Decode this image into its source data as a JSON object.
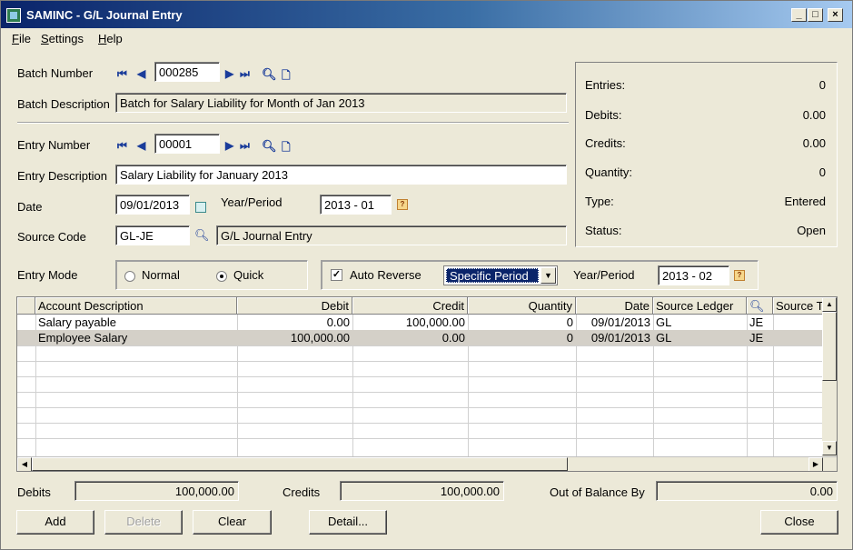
{
  "window": {
    "title": "SAMINC - G/L Journal Entry",
    "minimize": "_",
    "maximize": "□",
    "close": "×"
  },
  "menu": {
    "file": "File",
    "settings": "Settings",
    "help": "Help"
  },
  "batch": {
    "number_label": "Batch Number",
    "number": "000285",
    "description_label": "Batch Description",
    "description": "Batch for Salary Liability for Month of Jan 2013"
  },
  "entry": {
    "number_label": "Entry Number",
    "number": "00001",
    "description_label": "Entry Description",
    "description": "Salary Liability for January 2013",
    "date_label": "Date",
    "date": "09/01/2013",
    "year_period_label": "Year/Period",
    "year_period": "2013 - 01",
    "source_code_label": "Source Code",
    "source_code": "GL-JE",
    "source_code_desc": "G/L Journal Entry",
    "mode_label": "Entry Mode",
    "mode_normal": "Normal",
    "mode_quick": "Quick",
    "mode_selected": "Quick",
    "auto_reverse_label": "Auto Reverse",
    "auto_reverse_checked": true,
    "reverse_option": "Specific Period",
    "reverse_year_period_label": "Year/Period",
    "reverse_year_period": "2013 - 02"
  },
  "summary": {
    "entries_label": "Entries:",
    "entries": "0",
    "debits_label": "Debits:",
    "debits": "0.00",
    "credits_label": "Credits:",
    "credits": "0.00",
    "quantity_label": "Quantity:",
    "quantity": "0",
    "type_label": "Type:",
    "type": "Entered",
    "status_label": "Status:",
    "status": "Open"
  },
  "grid": {
    "columns": [
      "Account Description",
      "Debit",
      "Credit",
      "Quantity",
      "Date",
      "Source Ledger",
      "Source T"
    ],
    "rows": [
      {
        "account": "Salary payable",
        "debit": "0.00",
        "credit": "100,000.00",
        "quantity": "0",
        "date": "09/01/2013",
        "ledger": "GL",
        "type": "JE"
      },
      {
        "account": "Employee Salary",
        "debit": "100,000.00",
        "credit": "0.00",
        "quantity": "0",
        "date": "09/01/2013",
        "ledger": "GL",
        "type": "JE"
      }
    ]
  },
  "totals": {
    "debits_label": "Debits",
    "debits": "100,000.00",
    "credits_label": "Credits",
    "credits": "100,000.00",
    "oob_label": "Out of Balance By",
    "oob": "0.00"
  },
  "buttons": {
    "add": "Add",
    "delete": "Delete",
    "clear": "Clear",
    "detail": "Detail...",
    "close": "Close"
  },
  "icons": {
    "first": "first-icon",
    "prev": "previous-icon",
    "next": "next-icon",
    "last": "last-icon",
    "finder": "finder-icon",
    "new": "new-document-icon",
    "calendar": "calendar-icon"
  }
}
